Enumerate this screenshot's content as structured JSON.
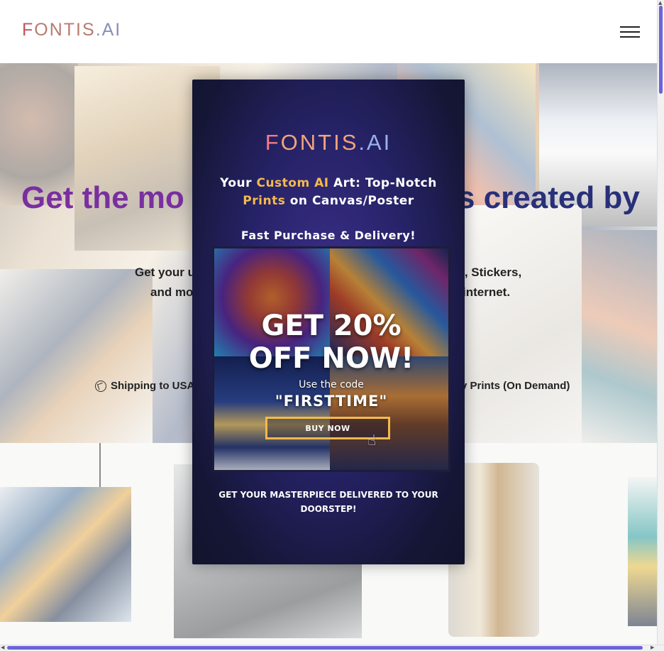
{
  "header": {
    "logo_part1": "F",
    "logo_part2": "ONTIS",
    "logo_part3": ".AI",
    "menu_icon": "hamburger-menu-icon"
  },
  "hero": {
    "title_visible_left": "Get the mo",
    "title_visible_right": "s created by",
    "subtitle_line1_left": "Get your u",
    "subtitle_line1_right": "gs, Stickers,",
    "subtitle_line2_left": "and mo",
    "subtitle_line2_right": "internet.",
    "feature1_icon": "globe-icon",
    "feature1": "Shipping to USA",
    "feature2": "y Prints (On Demand)"
  },
  "modal": {
    "logo_part1": "F",
    "logo_part2": "ONTIS",
    "logo_part3": ".AI",
    "headline_1": "Your ",
    "headline_accent1": "Custom AI",
    "headline_2": " Art: Top-Notch",
    "headline_accent2": "Prints",
    "headline_3": " on Canvas/Poster",
    "fast_purchase": "Fast Purchase & Delivery!",
    "promo_big_1": "GET 20%",
    "promo_big_2": "OFF NOW!",
    "promo_use": "Use the code",
    "promo_code": "\"FIRSTTIME\"",
    "buy_button": "BUY NOW",
    "footer_line1": "GET YOUR MASTERPIECE DELIVERED TO YOUR",
    "footer_line2": "DOORSTEP!"
  },
  "colors": {
    "accent": "#f5b94a",
    "modal_bg": "#1a1a40",
    "scroll_thumb": "#6b64d8"
  }
}
